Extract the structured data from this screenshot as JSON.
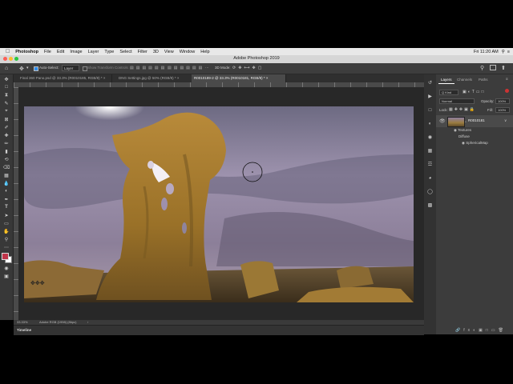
{
  "macmenu": {
    "apple": "",
    "app": "Photoshop",
    "items": [
      "File",
      "Edit",
      "Image",
      "Layer",
      "Type",
      "Select",
      "Filter",
      "3D",
      "View",
      "Window",
      "Help"
    ],
    "clock": "Fri 11:20 AM"
  },
  "window": {
    "title": "Adobe Photoshop 2019"
  },
  "options": {
    "auto_select_label": "Auto-Select:",
    "auto_select_value": "Layer",
    "show_transform": "Show Transform Controls",
    "mode3d": "3D Mode:"
  },
  "tabs": [
    {
      "label": "Final 360 Pano.psd @ 33.3% (R0010185, RGB/8) *",
      "active": false
    },
    {
      "label": "DNG Settings.jpg @ 50% (RGB/8) *",
      "active": false
    },
    {
      "label": "R0010189-2 @ 33.3% (R0010181, RGB/8) *",
      "active": true
    }
  ],
  "status": {
    "zoom": "33.33%",
    "profile": "Adobe RGB (1998) (8bpc)"
  },
  "timeline": {
    "label": "Timeline"
  },
  "layers_panel": {
    "tabs": [
      "Layers",
      "Channels",
      "Paths"
    ],
    "kind": "Q Kind",
    "blend": "Normal",
    "opacity_label": "Opacity:",
    "opacity": "100%",
    "lock_label": "Lock:",
    "fill_label": "Fill:",
    "fill": "100%",
    "layer_name": "R0010181",
    "sub_items": [
      "Textures",
      "Diffuse",
      "SphericalMap"
    ]
  },
  "colors": {
    "accent": "#2d8ceb",
    "sky": "#8e7f9e",
    "rock": "#a57d34"
  }
}
